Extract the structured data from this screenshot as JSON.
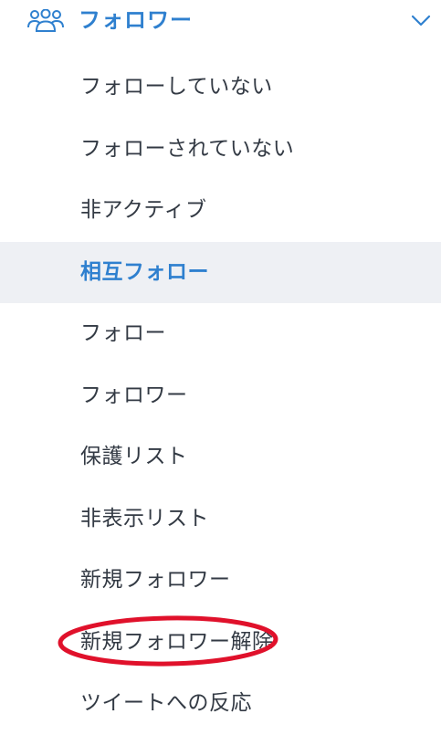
{
  "header": {
    "title": "フォロワー",
    "icon": "users-group-icon",
    "toggle_icon": "chevron-down-icon"
  },
  "menu": {
    "items": [
      {
        "label": "フォローしていない"
      },
      {
        "label": "フォローされていない"
      },
      {
        "label": "非アクティブ"
      },
      {
        "label": "相互フォロー"
      },
      {
        "label": "フォロー"
      },
      {
        "label": "フォロワー"
      },
      {
        "label": "保護リスト"
      },
      {
        "label": "非表示リスト"
      },
      {
        "label": "新規フォロワー"
      },
      {
        "label": "新規フォロワー解除"
      },
      {
        "label": "ツイートへの反応"
      }
    ],
    "active_item": "相互フォロー",
    "circled_item": "新規フォロワー解除"
  },
  "colors": {
    "accent": "#2f80cf",
    "text": "#333a44",
    "active_background": "#eef0f4",
    "annotation": "#e0112b"
  }
}
